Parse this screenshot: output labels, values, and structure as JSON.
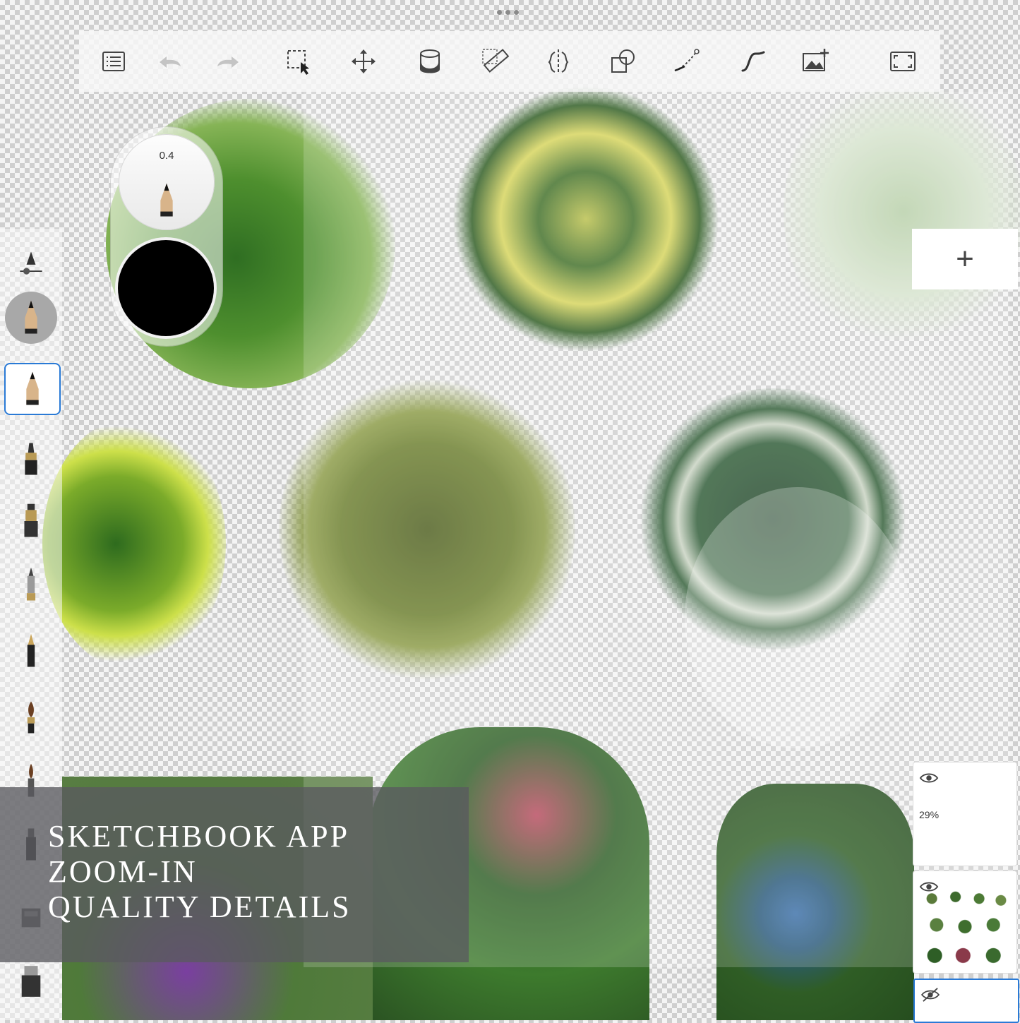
{
  "toolbar": {
    "items": [
      {
        "name": "list-icon"
      },
      {
        "name": "undo-icon"
      },
      {
        "name": "redo-icon"
      },
      {
        "name": "selection-icon"
      },
      {
        "name": "move-icon"
      },
      {
        "name": "fill-icon"
      },
      {
        "name": "ruler-icon"
      },
      {
        "name": "symmetry-icon"
      },
      {
        "name": "shapes-icon"
      },
      {
        "name": "curve-icon"
      },
      {
        "name": "stroke-icon"
      },
      {
        "name": "add-image-icon"
      },
      {
        "name": "fullscreen-icon"
      }
    ]
  },
  "brush_puck": {
    "size_value": "0.4",
    "color": "#000000"
  },
  "layers": {
    "add_label": "+",
    "layer1_opacity": "29%"
  },
  "caption": {
    "line1": "SKETCHBOOK APP",
    "line2": "ZOOM-IN",
    "line3": "QUALITY DETAILS"
  }
}
